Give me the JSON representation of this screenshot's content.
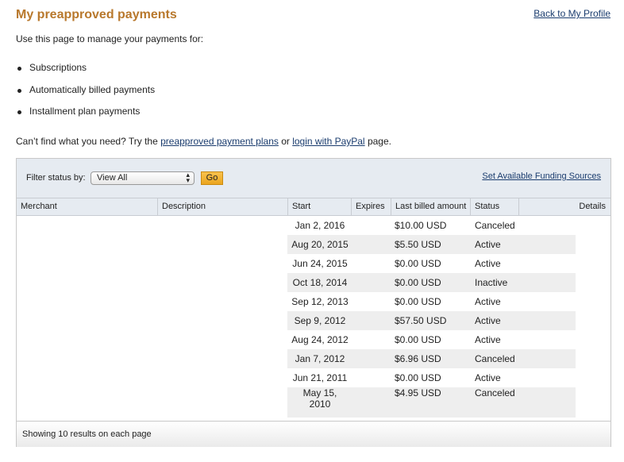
{
  "page": {
    "title": "My preapproved payments",
    "back_link": "Back to My Profile",
    "intro": "Use this page to manage your payments for:",
    "bullets": [
      "Subscriptions",
      "Automatically billed payments",
      "Installment plan payments"
    ],
    "cant_find": {
      "prefix": "Can’t find what you need? Try the ",
      "link1": "preapproved payment plans",
      "middle": " or ",
      "link2": "login with PayPal",
      "suffix": " page."
    }
  },
  "toolbar": {
    "filter_label": "Filter status by:",
    "filter_value": "View All",
    "go_label": "Go",
    "funding_link": "Set Available Funding Sources"
  },
  "columns": [
    "Merchant",
    "Description",
    "Start",
    "Expires",
    "Last billed amount",
    "Status",
    "Details"
  ],
  "rows": [
    {
      "start": "Jan 2, 2016",
      "amount": "$10.00 USD",
      "status": "Canceled"
    },
    {
      "start": "Aug 20, 2015",
      "amount": "$5.50 USD",
      "status": "Active"
    },
    {
      "start": "Jun 24, 2015",
      "amount": "$0.00 USD",
      "status": "Active"
    },
    {
      "start": "Oct 18, 2014",
      "amount": "$0.00 USD",
      "status": "Inactive"
    },
    {
      "start": "Sep 12, 2013",
      "amount": "$0.00 USD",
      "status": "Active"
    },
    {
      "start": "Sep 9, 2012",
      "amount": "$57.50 USD",
      "status": "Active"
    },
    {
      "start": "Aug 24, 2012",
      "amount": "$0.00 USD",
      "status": "Active"
    },
    {
      "start": "Jan 7, 2012",
      "amount": "$6.96 USD",
      "status": "Canceled"
    },
    {
      "start": "Jun 21, 2011",
      "amount": "$0.00 USD",
      "status": "Active"
    },
    {
      "start": "May 15, 2010",
      "amount": "$4.95 USD",
      "status": "Canceled"
    }
  ],
  "footer": {
    "text": "Showing 10 results on each page"
  },
  "colors": {
    "title": "#b8782c",
    "link": "#1a3c6e",
    "header_bg": "#e6ebf1",
    "stripe": "#eeeeee",
    "go_button": "#f1b233"
  }
}
